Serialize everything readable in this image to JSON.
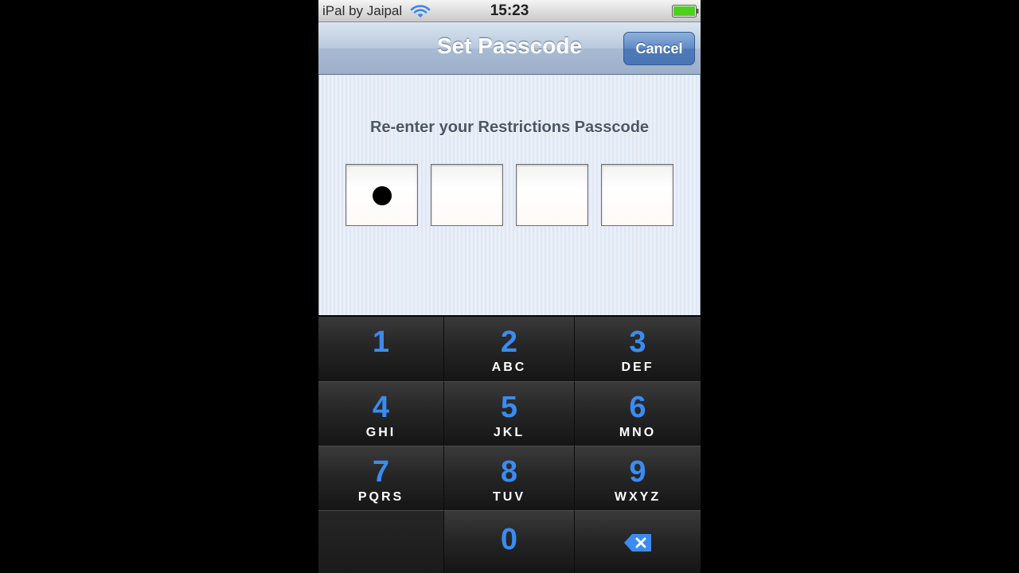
{
  "status_bar": {
    "carrier": "iPal by Jaipal",
    "time": "15:23",
    "wifi_icon": "wifi-icon",
    "battery_icon": "battery-icon",
    "battery_color": "#4cd21c"
  },
  "nav_bar": {
    "title": "Set Passcode",
    "cancel_label": "Cancel"
  },
  "content": {
    "prompt": "Re-enter your Restrictions Passcode",
    "passcode_length": 4,
    "digits_entered": 1
  },
  "keypad": {
    "digit_color": "#3b8bf0",
    "keys": [
      {
        "digit": "1",
        "letters": ""
      },
      {
        "digit": "2",
        "letters": "ABC"
      },
      {
        "digit": "3",
        "letters": "DEF"
      },
      {
        "digit": "4",
        "letters": "GHI"
      },
      {
        "digit": "5",
        "letters": "JKL"
      },
      {
        "digit": "6",
        "letters": "MNO"
      },
      {
        "digit": "7",
        "letters": "PQRS"
      },
      {
        "digit": "8",
        "letters": "TUV"
      },
      {
        "digit": "9",
        "letters": "WXYZ"
      },
      {
        "digit": "0",
        "letters": ""
      }
    ],
    "delete_icon": "delete-backspace-icon"
  }
}
